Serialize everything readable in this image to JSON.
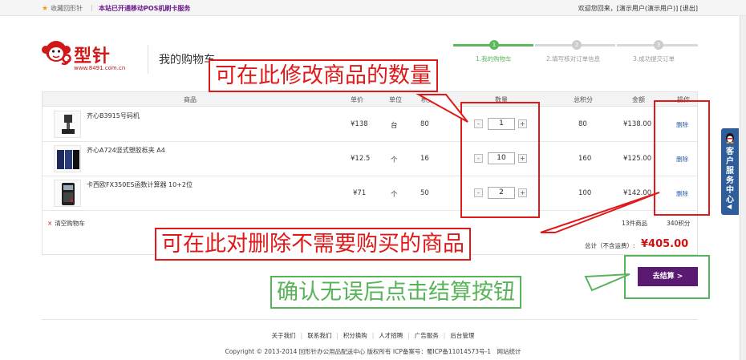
{
  "topbar": {
    "favorite_label": "收藏回形针",
    "separator": "|",
    "notice": "本站已开通移动POS机刷卡服务",
    "welcome": "欢迎您回来，[演示用户(演示用户)] [退出]"
  },
  "logo": {
    "brand": "型针",
    "url": "www.8491.com.cn"
  },
  "page_title": "我的购物车",
  "steps": [
    {
      "num": "1",
      "label": "1.我的购物车",
      "active": true
    },
    {
      "num": "2",
      "label": "2.填写核对订单信息",
      "active": false
    },
    {
      "num": "3",
      "label": "3.成功提交订单",
      "active": false
    }
  ],
  "colors": {
    "active_step": "#5cb85c",
    "inactive_step": "#d8d8d8",
    "accent_purple": "#5a1a72",
    "price_red": "#d01010",
    "annot_red": "#e01a1a",
    "annot_green": "#58b458"
  },
  "table": {
    "headers": {
      "product": "商品",
      "price": "单价",
      "unit": "单位",
      "points": "积分",
      "qty": "数量",
      "total_points": "总积分",
      "amount": "金额",
      "action": "操作"
    },
    "rows": [
      {
        "name": "齐心B3915号码机",
        "price": "¥138",
        "unit": "台",
        "points": "80",
        "qty": "1",
        "total_points": "80",
        "amount": "¥138.00",
        "action": "删除"
      },
      {
        "name": "齐心A724竖式塑胶栎夹 A4",
        "price": "¥12.5",
        "unit": "个",
        "points": "16",
        "qty": "10",
        "total_points": "160",
        "amount": "¥125.00",
        "action": "删除"
      },
      {
        "name": "卡西欧FX350ES函数计算器 10+2位",
        "price": "¥71",
        "unit": "个",
        "points": "50",
        "qty": "2",
        "total_points": "100",
        "amount": "¥142.00",
        "action": "删除"
      }
    ],
    "minus": "-",
    "plus": "+"
  },
  "summary": {
    "clear_cart": "清空购物车",
    "clear_icon": "×",
    "item_count": "13件商品",
    "total_points": "340积分",
    "total_label": "总计（不含运费）:",
    "total_amount": "¥405.00"
  },
  "checkout_label": "去结算 >",
  "annotations": {
    "qty": "可在此修改商品的数量",
    "delete": "可在此对删除不需要购买的商品",
    "checkout": "确认无误后点击结算按钮"
  },
  "footer": {
    "links": [
      "关于我们",
      "联系我们",
      "积分换购",
      "人才招聘",
      "广告服务",
      "后台管理"
    ],
    "copyright": "Copyright © 2013-2014 回形针办公用品配送中心 版权所有 ICP备案号：蜀ICP备11014573号-1　网站统计"
  },
  "side_service": {
    "label": "客户服务中心",
    "arrow": "◀"
  }
}
